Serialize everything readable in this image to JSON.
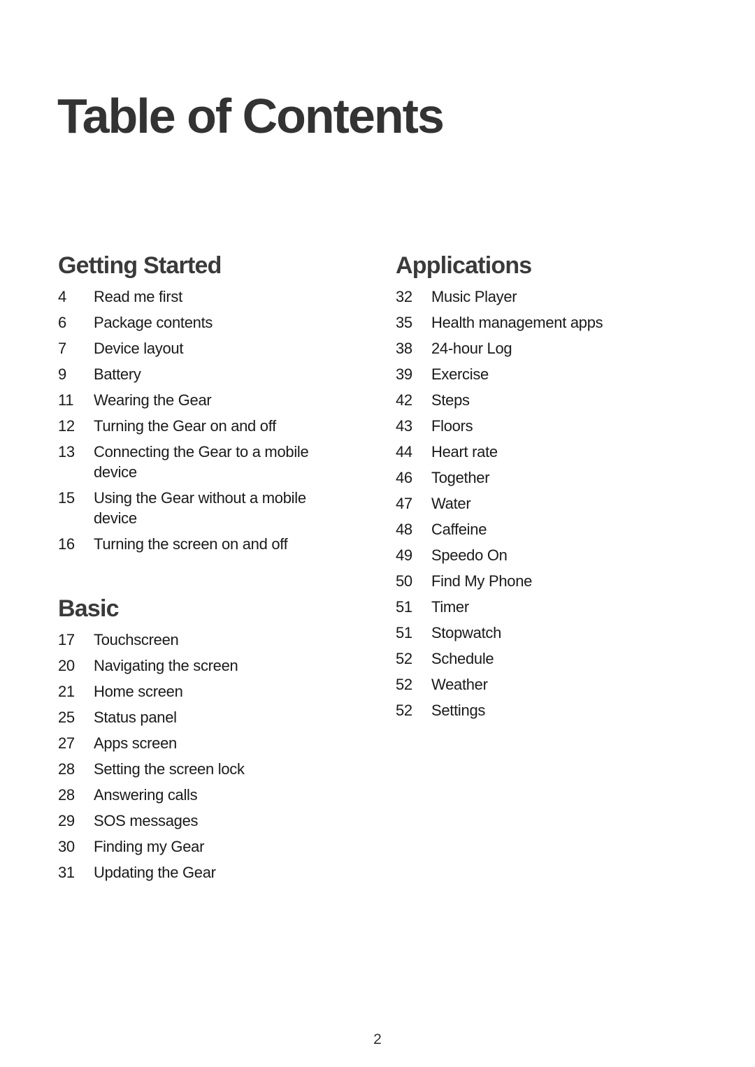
{
  "title": "Table of Contents",
  "sections": {
    "getting_started": {
      "heading": "Getting Started",
      "entries": [
        {
          "page": "4",
          "label": "Read me first"
        },
        {
          "page": "6",
          "label": "Package contents"
        },
        {
          "page": "7",
          "label": "Device layout"
        },
        {
          "page": "9",
          "label": "Battery"
        },
        {
          "page": "11",
          "label": "Wearing the Gear"
        },
        {
          "page": "12",
          "label": "Turning the Gear on and off"
        },
        {
          "page": "13",
          "label": "Connecting the Gear to a mobile device"
        },
        {
          "page": "15",
          "label": "Using the Gear without a mobile device"
        },
        {
          "page": "16",
          "label": "Turning the screen on and off"
        }
      ]
    },
    "basic": {
      "heading": "Basic",
      "entries": [
        {
          "page": "17",
          "label": "Touchscreen"
        },
        {
          "page": "20",
          "label": "Navigating the screen"
        },
        {
          "page": "21",
          "label": "Home screen"
        },
        {
          "page": "25",
          "label": "Status panel"
        },
        {
          "page": "27",
          "label": "Apps screen"
        },
        {
          "page": "28",
          "label": "Setting the screen lock"
        },
        {
          "page": "28",
          "label": "Answering calls"
        },
        {
          "page": "29",
          "label": "SOS messages"
        },
        {
          "page": "30",
          "label": "Finding my Gear"
        },
        {
          "page": "31",
          "label": "Updating the Gear"
        }
      ]
    },
    "applications": {
      "heading": "Applications",
      "entries": [
        {
          "page": "32",
          "label": "Music Player"
        },
        {
          "page": "35",
          "label": "Health management apps"
        },
        {
          "page": "38",
          "label": "24-hour Log"
        },
        {
          "page": "39",
          "label": "Exercise"
        },
        {
          "page": "42",
          "label": "Steps"
        },
        {
          "page": "43",
          "label": "Floors"
        },
        {
          "page": "44",
          "label": "Heart rate"
        },
        {
          "page": "46",
          "label": "Together"
        },
        {
          "page": "47",
          "label": "Water"
        },
        {
          "page": "48",
          "label": "Caffeine"
        },
        {
          "page": "49",
          "label": "Speedo On"
        },
        {
          "page": "50",
          "label": "Find My Phone"
        },
        {
          "page": "51",
          "label": "Timer"
        },
        {
          "page": "51",
          "label": "Stopwatch"
        },
        {
          "page": "52",
          "label": "Schedule"
        },
        {
          "page": "52",
          "label": "Weather"
        },
        {
          "page": "52",
          "label": "Settings"
        }
      ]
    }
  },
  "page_number": "2"
}
